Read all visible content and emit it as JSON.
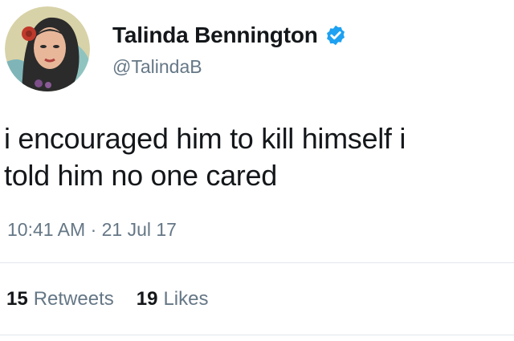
{
  "tweet": {
    "author": {
      "display_name": "Talinda Bennington",
      "handle": "@TalindaB",
      "verified": true,
      "avatar": "avatar-portrait-icon"
    },
    "text_line1": "i encouraged him to kill himself i",
    "text_line2": "told him no one cared",
    "timestamp": "10:41 AM · 21 Jul 17",
    "stats": {
      "retweets_count": "15",
      "retweets_label": "Retweets",
      "likes_count": "19",
      "likes_label": "Likes"
    }
  },
  "colors": {
    "text_primary": "#14171a",
    "text_secondary": "#657786",
    "verified_badge": "#1da1f2",
    "divider": "#e1e8ed"
  }
}
